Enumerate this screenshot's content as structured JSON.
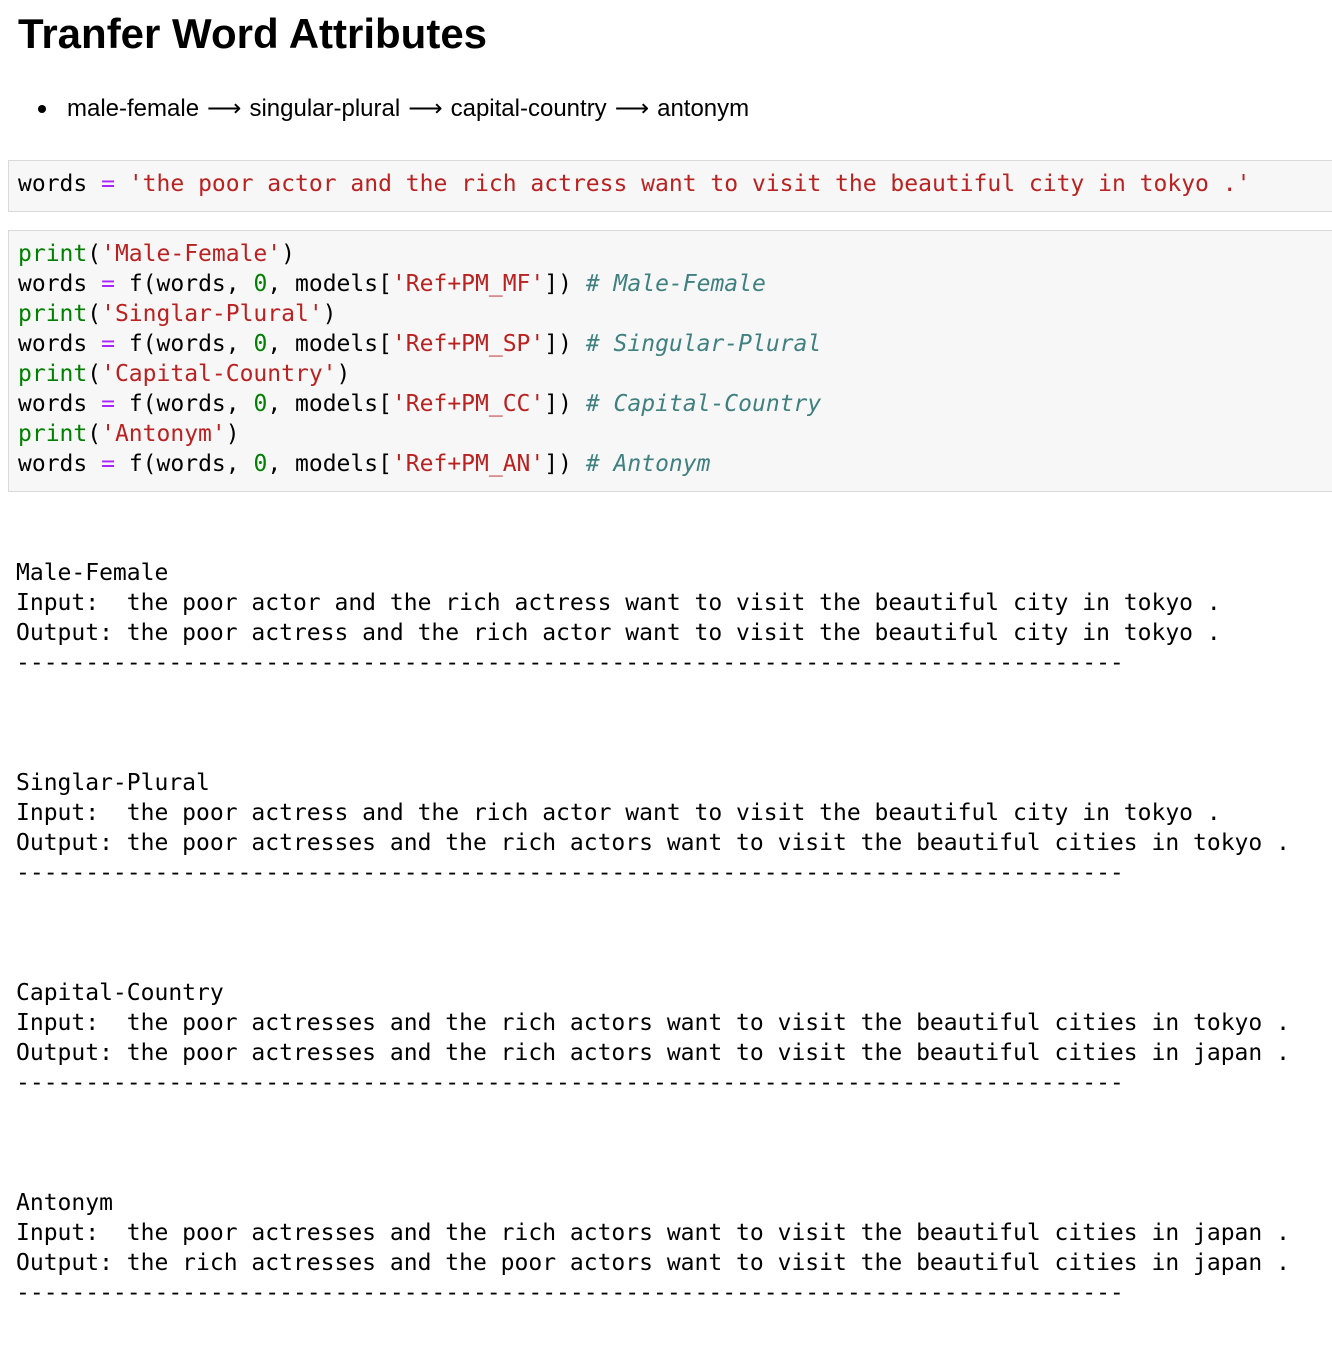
{
  "title": "Tranfer Word Attributes",
  "bullet": {
    "items": [
      "male-female",
      "singular-plural",
      "capital-country",
      "antonym"
    ],
    "arrow": "⟶"
  },
  "cell1": {
    "var": "words",
    "op": "=",
    "string": "'the poor actor and the rich actress want to visit the beautiful city in tokyo .'"
  },
  "cell2": {
    "lines": [
      {
        "print_kw": "print",
        "print_arg": "'Male-Female'",
        "tag": "'Ref+PM_MF'",
        "comment": "# Male-Female"
      },
      {
        "print_kw": "print",
        "print_arg": "'Singlar-Plural'",
        "tag": "'Ref+PM_SP'",
        "comment": "# Singular-Plural"
      },
      {
        "print_kw": "print",
        "print_arg": "'Capital-Country'",
        "tag": "'Ref+PM_CC'",
        "comment": "# Capital-Country"
      },
      {
        "print_kw": "print",
        "print_arg": "'Antonym'",
        "tag": "'Ref+PM_AN'",
        "comment": "# Antonym"
      }
    ],
    "call_prefix": "f(words, ",
    "call_zero": "0",
    "call_mid": ", models[",
    "call_end": "])",
    "var": "words",
    "op": "="
  },
  "output": [
    {
      "header": "Male-Female",
      "input": "Input:  the poor actor and the rich actress want to visit the beautiful city in tokyo .",
      "output": "Output: the poor actress and the rich actor want to visit the beautiful city in tokyo .",
      "sep": "--------------------------------------------------------------------------------"
    },
    {
      "header": "Singlar-Plural",
      "input": "Input:  the poor actress and the rich actor want to visit the beautiful city in tokyo .",
      "output": "Output: the poor actresses and the rich actors want to visit the beautiful cities in tokyo .",
      "sep": "--------------------------------------------------------------------------------"
    },
    {
      "header": "Capital-Country",
      "input": "Input:  the poor actresses and the rich actors want to visit the beautiful cities in tokyo .",
      "output": "Output: the poor actresses and the rich actors want to visit the beautiful cities in japan .",
      "sep": "--------------------------------------------------------------------------------"
    },
    {
      "header": "Antonym",
      "input": "Input:  the poor actresses and the rich actors want to visit the beautiful cities in japan .",
      "output": "Output: the rich actresses and the poor actors want to visit the beautiful cities in japan .",
      "sep": "--------------------------------------------------------------------------------"
    }
  ]
}
